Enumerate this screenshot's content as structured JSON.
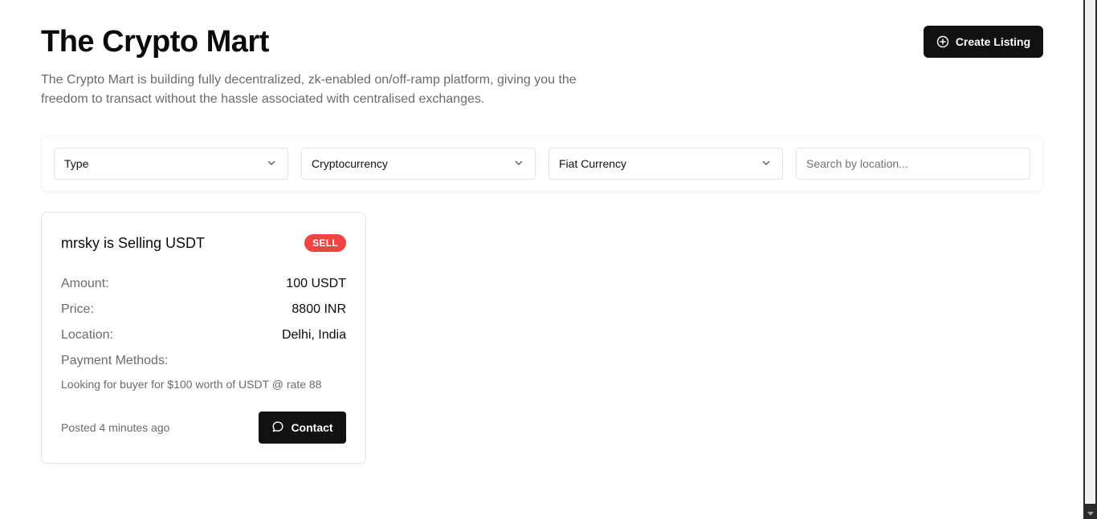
{
  "header": {
    "title": "The Crypto Mart",
    "subtitle": "The Crypto Mart is building fully decentralized, zk-enabled on/off-ramp platform, giving you the freedom to transact without the hassle associated with centralised exchanges.",
    "create_label": "Create Listing",
    "create_icon": "plus-circle-icon"
  },
  "filters": {
    "type": "Type",
    "cryptocurrency": "Cryptocurrency",
    "fiat_currency": "Fiat Currency",
    "location_placeholder": "Search by location...",
    "dropdown_icon": "chevron-down-icon"
  },
  "listings": [
    {
      "title": "mrsky is Selling USDT",
      "badge": "SELL",
      "badge_color": "#ef4444",
      "amount_label": "Amount:",
      "amount_value": "100 USDT",
      "price_label": "Price:",
      "price_value": "8800 INR",
      "location_label": "Location:",
      "location_value": "Delhi, India",
      "payment_label": "Payment Methods:",
      "description": "Looking for buyer for $100 worth of USDT @ rate 88",
      "posted": "Posted 4 minutes ago",
      "contact_label": "Contact",
      "contact_icon": "message-circle-icon"
    }
  ],
  "colors": {
    "primary_button": "#111111",
    "muted_text": "#6b6b6b",
    "sell_badge": "#ef4444"
  }
}
